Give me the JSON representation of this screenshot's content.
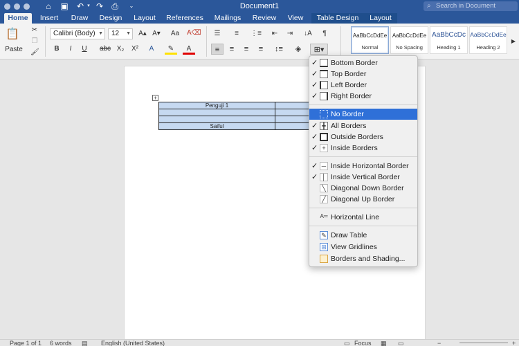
{
  "titlebar": {
    "title": "Document1",
    "search_placeholder": "Search in Document",
    "icons": [
      "home-icon",
      "save-icon",
      "undo-icon",
      "redo-icon",
      "print-icon",
      "customize-icon"
    ]
  },
  "tabs": [
    "Home",
    "Insert",
    "Draw",
    "Design",
    "Layout",
    "References",
    "Mailings",
    "Review",
    "View",
    "Table Design",
    "Layout"
  ],
  "active_tab": "Home",
  "ribbon": {
    "paste_label": "Paste",
    "font_name": "Calibri (Body)",
    "font_size": "12",
    "bold": "B",
    "italic": "I",
    "underline": "U",
    "strikethrough": "abc",
    "subscript": "X₂",
    "superscript": "X²",
    "styles": [
      {
        "sample": "AaBbCcDdEe",
        "name": "Normal"
      },
      {
        "sample": "AaBbCcDdEe",
        "name": "No Spacing"
      },
      {
        "sample": "AaBbCcDc",
        "name": "Heading 1"
      },
      {
        "sample": "AaBbCcDdEe",
        "name": "Heading 2"
      }
    ]
  },
  "document": {
    "table_rows": [
      [
        "Penguji 1",
        ""
      ],
      [
        "",
        ""
      ],
      [
        "",
        ""
      ],
      [
        "Saiful",
        ""
      ]
    ]
  },
  "border_menu": {
    "items": [
      {
        "label": "Bottom Border",
        "checked": true,
        "icon": "bottom-border-icon"
      },
      {
        "label": "Top Border",
        "checked": true,
        "icon": "top-border-icon"
      },
      {
        "label": "Left Border",
        "checked": true,
        "icon": "left-border-icon"
      },
      {
        "label": "Right Border",
        "checked": true,
        "icon": "right-border-icon"
      },
      {
        "label": "No Border",
        "checked": false,
        "icon": "no-border-icon",
        "highlighted": true
      },
      {
        "label": "All Borders",
        "checked": true,
        "icon": "all-borders-icon"
      },
      {
        "label": "Outside Borders",
        "checked": true,
        "icon": "outside-borders-icon"
      },
      {
        "label": "Inside Borders",
        "checked": true,
        "icon": "inside-borders-icon"
      },
      {
        "label": "Inside Horizontal Border",
        "checked": true,
        "icon": "inside-horizontal-border-icon"
      },
      {
        "label": "Inside Vertical Border",
        "checked": true,
        "icon": "inside-vertical-border-icon"
      },
      {
        "label": "Diagonal Down Border",
        "checked": false,
        "icon": "diagonal-down-border-icon"
      },
      {
        "label": "Diagonal Up Border",
        "checked": false,
        "icon": "diagonal-up-border-icon"
      },
      {
        "label": "Horizontal Line",
        "checked": false,
        "icon": "horizontal-line-icon"
      },
      {
        "label": "Draw Table",
        "checked": false,
        "icon": "draw-table-icon"
      },
      {
        "label": "View Gridlines",
        "checked": false,
        "icon": "view-gridlines-icon"
      },
      {
        "label": "Borders and Shading...",
        "checked": false,
        "icon": "borders-shading-icon"
      }
    ]
  },
  "statusbar": {
    "page": "Page 1 of 1",
    "words": "6 words",
    "language": "English (United States)",
    "focus": "Focus"
  },
  "colors": {
    "brand": "#2b579a",
    "highlight": "#2f70d8",
    "table_fill": "#c6d9f1"
  }
}
